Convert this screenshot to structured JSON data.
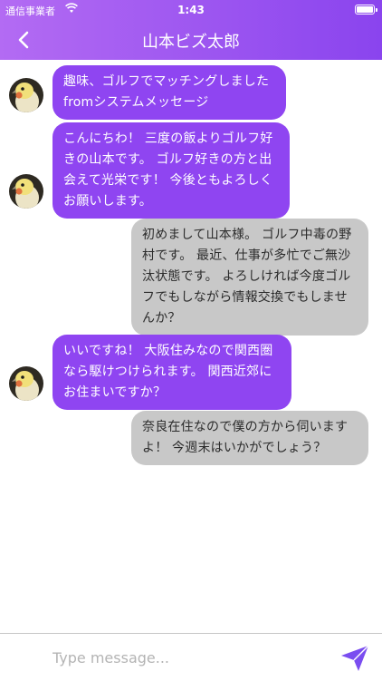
{
  "status": {
    "carrier": "通信事業者",
    "time": "1:43"
  },
  "header": {
    "title": "山本ビズ太郎"
  },
  "messages": [
    {
      "side": "in",
      "text": "趣味、ゴルフでマッチングしました fromシステムメッセージ"
    },
    {
      "side": "in",
      "text": "こんにちわ！ 三度の飯よりゴルフ好きの山本です。 ゴルフ好きの方と出会えて光栄です！ 今後ともよろしくお願いします。"
    },
    {
      "side": "out",
      "text": "初めまして山本様。 ゴルフ中毒の野村です。 最近、仕事が多忙でご無沙汰状態です。 よろしければ今度ゴルフでもしながら情報交換でもしませんか？"
    },
    {
      "side": "in",
      "text": "いいですね！ 大阪住みなので関西圏なら駆けつけられます。 関西近郊にお住まいですか？"
    },
    {
      "side": "out",
      "text": "奈良在住なので僕の方から伺いますよ！ 今週末はいかがでしょう？"
    }
  ],
  "composer": {
    "placeholder": "Type message..."
  },
  "colors": {
    "header_start": "#b36bf3",
    "header_end": "#8a44ee",
    "incoming": "#8f45f1",
    "outgoing": "#c8c8c8"
  },
  "icons": {
    "back": "chevron-left-icon",
    "send": "paper-plane-icon",
    "avatar": "cockatiel-avatar"
  }
}
